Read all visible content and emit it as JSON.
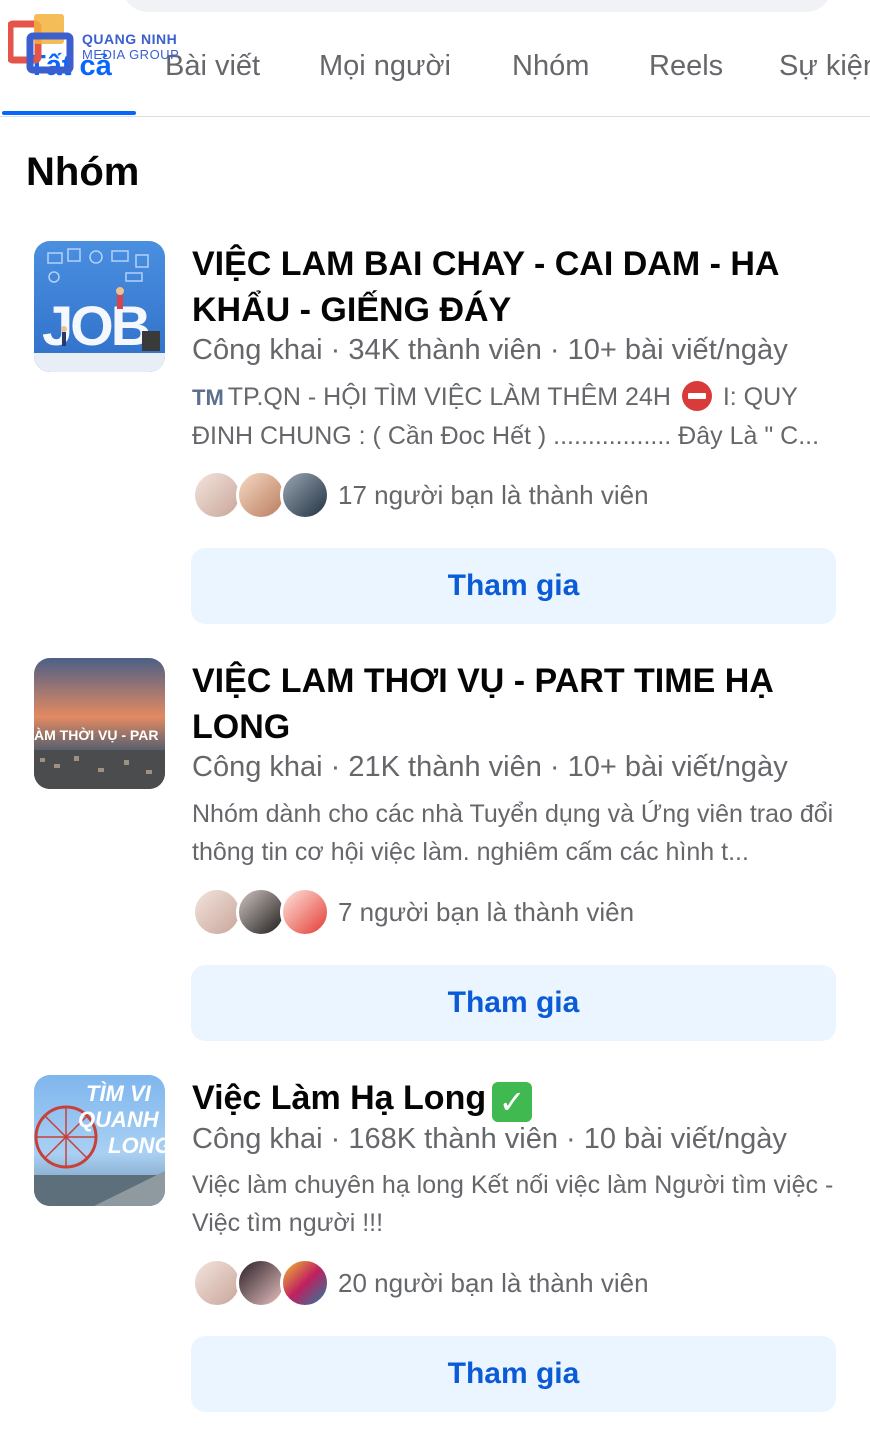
{
  "watermark": {
    "line1": "QUANG NINH",
    "line2": "MEDIA GROUP",
    "logo_icon": "qmg-logo-icon"
  },
  "tabs": [
    {
      "label": "Tất cả",
      "active": true
    },
    {
      "label": "Bài viết",
      "active": false
    },
    {
      "label": "Mọi người",
      "active": false
    },
    {
      "label": "Nhóm",
      "active": false
    },
    {
      "label": "Reels",
      "active": false
    },
    {
      "label": "Sự kiện",
      "active": false
    }
  ],
  "section_title": "Nhóm",
  "groups": [
    {
      "name": "VIỆC LAM BAI CHAY - CAI DAM - HA KHẨU - GIẾNG ĐÁY",
      "meta": "Công khai · 34K thành viên · 10+ bài viết/ngày",
      "desc_tag": "TM",
      "desc_part1": "TP.QN - HỘI TÌM VIỆC LÀM THÊM 24H",
      "desc_icon": "no-entry-icon",
      "desc_part2": "I: QUY ĐINH CHUNG : ( Cần Đoc Hết ) ................. Đây Là \" C...",
      "thumb_text": "JOB",
      "friends_text": "17 người bạn là thành viên",
      "join_label": "Tham gia"
    },
    {
      "name": "VIỆC LAM THƠI VỤ - PART TIME HẠ LONG",
      "meta": "Công khai · 21K thành viên · 10+ bài viết/ngày",
      "desc": "Nhóm dành cho các nhà Tuyển dụng và Ứng viên trao đổi thông tin cơ hội việc làm. nghiêm cấm các hình t...",
      "thumb_text": "ÀM THỜI VỤ - PAR",
      "friends_text": "7 người bạn là thành viên",
      "join_label": "Tham gia"
    },
    {
      "name": "Việc Làm Hạ Long",
      "badge": "✓",
      "meta": "Công khai · 168K thành viên · 10 bài viết/ngày",
      "desc": "Việc làm chuyên hạ long Kết nối việc làm Người tìm việc - Việc tìm người !!!",
      "thumb_text1": "TÌM VI",
      "thumb_text2": "QUANH",
      "thumb_text3": "LONG",
      "friends_text": "20 người bạn là thành viên",
      "join_label": "Tham gia"
    }
  ]
}
